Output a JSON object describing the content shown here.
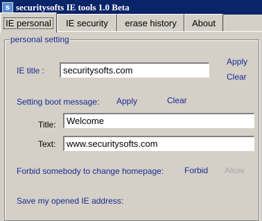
{
  "window": {
    "title": "securitysofts IE tools 1.0 Beta",
    "icon": "app-icon"
  },
  "tabs": [
    {
      "label": "IE personal",
      "active": true
    },
    {
      "label": "IE security",
      "active": false
    },
    {
      "label": "erase history",
      "active": false
    },
    {
      "label": "About",
      "active": false
    }
  ],
  "personal": {
    "group_title": "personal setting",
    "ie_title_label": "IE title :",
    "ie_title_value": "securitysofts.com",
    "ie_title_apply": "Apply",
    "ie_title_clear": "Clear",
    "boot_label": "Setting boot message:",
    "boot_apply": "Apply",
    "boot_clear": "Clear",
    "title_label": "Title:",
    "title_value": "Welcome",
    "text_label": "Text:",
    "text_value": "www.securitysofts.com",
    "forbid_label": "Forbid somebody to change homepage:",
    "forbid_link": "Forbid",
    "allow_link": "Allow",
    "save_label": "Save my opened IE address:"
  }
}
